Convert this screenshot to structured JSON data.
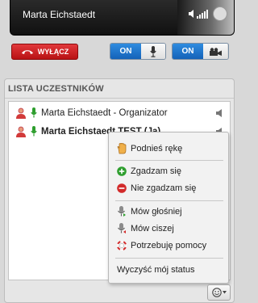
{
  "video": {
    "speaker_name": "Marta Eichstaedt"
  },
  "controls": {
    "hangup_label": "WYŁĄCZ",
    "mic_toggle_state": "ON",
    "camera_toggle_state": "ON"
  },
  "participants": {
    "title": "LISTA UCZESTNIKÓW",
    "rows": [
      {
        "name": "Marta Eichstaedt - Organizator",
        "bold": false
      },
      {
        "name": "Marta Eichstaedt TEST (Ja)",
        "bold": true
      }
    ]
  },
  "status_menu": {
    "items": [
      {
        "label": "Podnieś rękę",
        "icon": "raise-hand-icon"
      },
      {
        "label": "Zgadzam się",
        "icon": "agree-icon"
      },
      {
        "label": "Nie zgadzam się",
        "icon": "disagree-icon"
      },
      {
        "label": "Mów głośniej",
        "icon": "speak-louder-icon"
      },
      {
        "label": "Mów ciszej",
        "icon": "speak-quieter-icon"
      },
      {
        "label": "Potrzebuję pomocy",
        "icon": "need-help-icon"
      },
      {
        "label": "Wyczyść mój status",
        "icon": ""
      }
    ]
  },
  "colors": {
    "hangup": "#d21f22",
    "toggle_on": "#1f77d0",
    "agree": "#2e9e2e",
    "disagree": "#d22a2a"
  }
}
